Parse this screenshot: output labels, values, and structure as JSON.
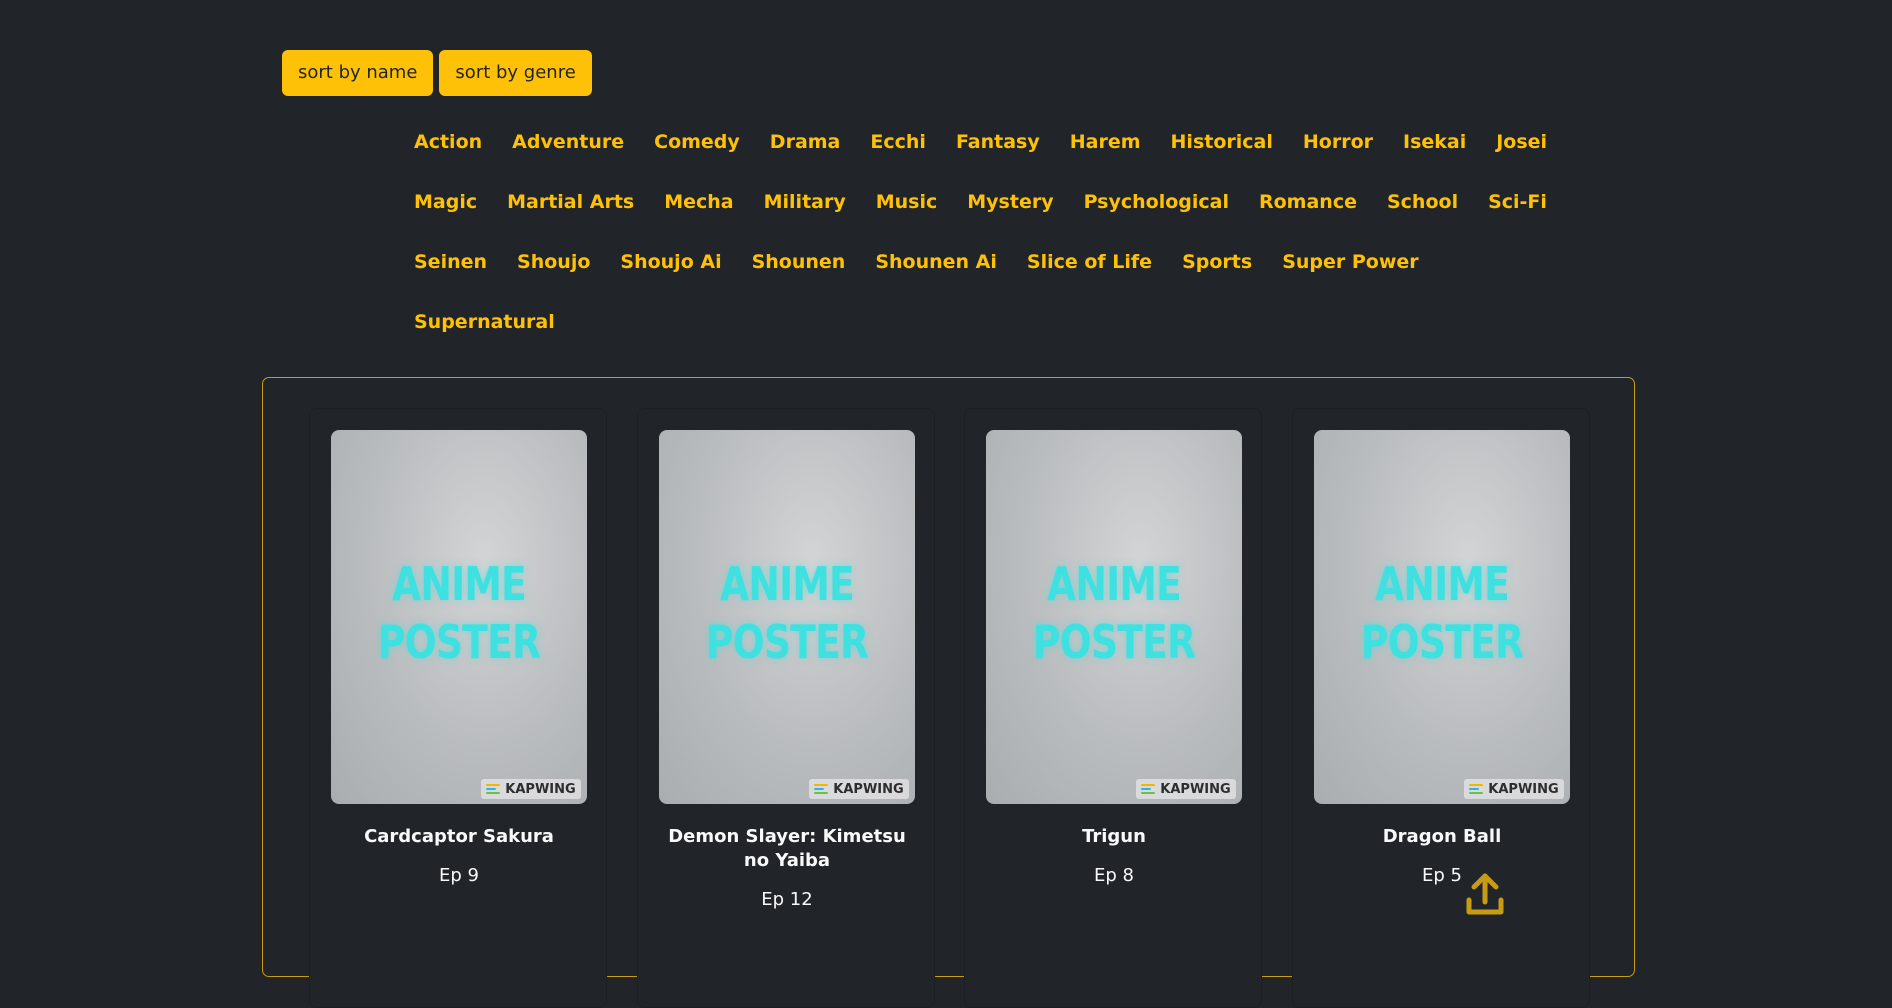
{
  "sort_bar": {
    "by_name_label": "sort by name",
    "by_genre_label": "sort by genre"
  },
  "genres": [
    [
      "Action",
      "Adventure",
      "Comedy",
      "Drama",
      "Ecchi",
      "Fantasy",
      "Harem",
      "Historical",
      "Horror",
      "Isekai",
      "Josei"
    ],
    [
      "Magic",
      "Martial Arts",
      "Mecha",
      "Military",
      "Music",
      "Mystery",
      "Psychological",
      "Romance",
      "School",
      "Sci-Fi"
    ],
    [
      "Seinen",
      "Shoujo",
      "Shoujo Ai",
      "Shounen",
      "Shounen Ai",
      "Slice of Life",
      "Sports",
      "Super Power"
    ],
    [
      "Supernatural"
    ]
  ],
  "poster": {
    "text_line1": "ANIME",
    "text_line2": "POSTER",
    "watermark": "KAPWING"
  },
  "anime_list": [
    {
      "title": "Cardcaptor Sakura",
      "episode": "Ep 9"
    },
    {
      "title": "Demon Slayer: Kimetsu no Yaiba",
      "episode": "Ep 12"
    },
    {
      "title": "Trigun",
      "episode": "Ep 8"
    },
    {
      "title": "Dragon Ball",
      "episode": "Ep 5"
    }
  ],
  "icons": {
    "scroll_top": "arrow-up-from-tray-icon"
  },
  "colors": {
    "background": "#212529",
    "accent": "#ffc107",
    "panel_border": "#c99a14",
    "text": "#f8f9fa",
    "poster_text": "#3fe0e0"
  }
}
